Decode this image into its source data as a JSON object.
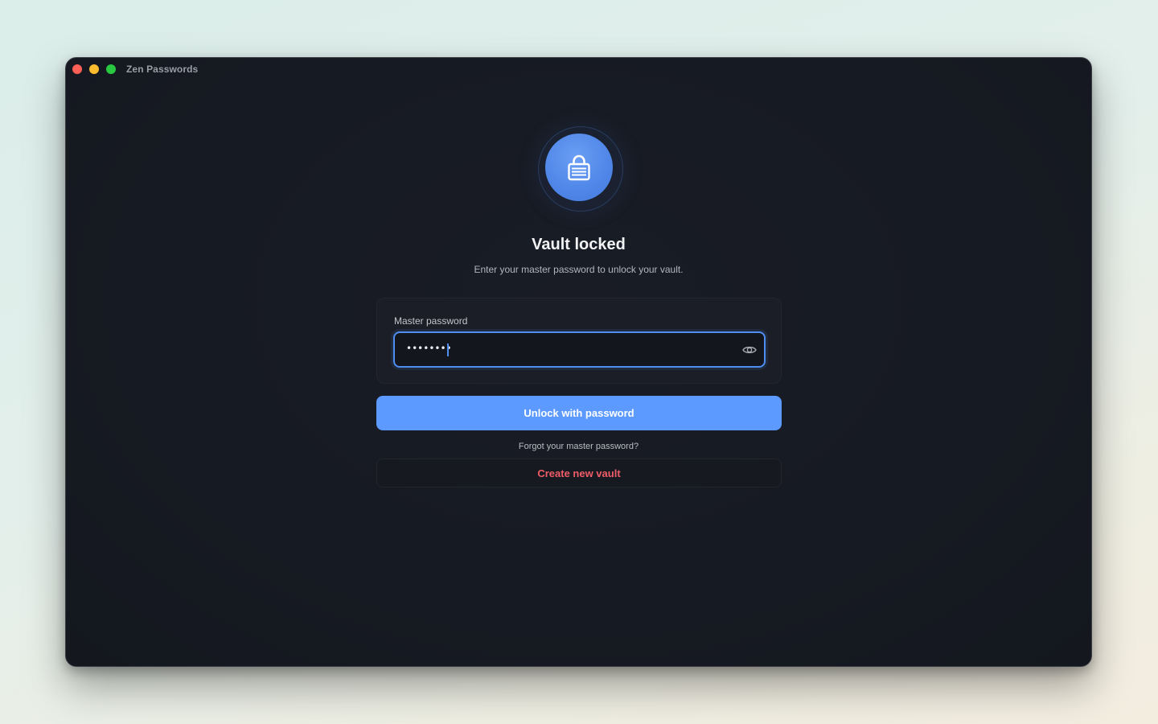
{
  "window": {
    "app_title": "Zen Passwords"
  },
  "lock": {
    "icon": "lock-icon",
    "accent": "#4f86e8"
  },
  "main": {
    "heading": "Vault locked",
    "subtitle": "Enter your master password to unlock your vault."
  },
  "form": {
    "label": "Master password",
    "password_masked": "••••••••",
    "reveal_icon": "eye-icon"
  },
  "actions": {
    "unlock_label": "Unlock with password",
    "forgot_label": "Forgot your master password?",
    "create_label": "Create new vault"
  },
  "colors": {
    "primary": "#5c9aff",
    "danger": "#f05d68",
    "background": "#161a22"
  }
}
